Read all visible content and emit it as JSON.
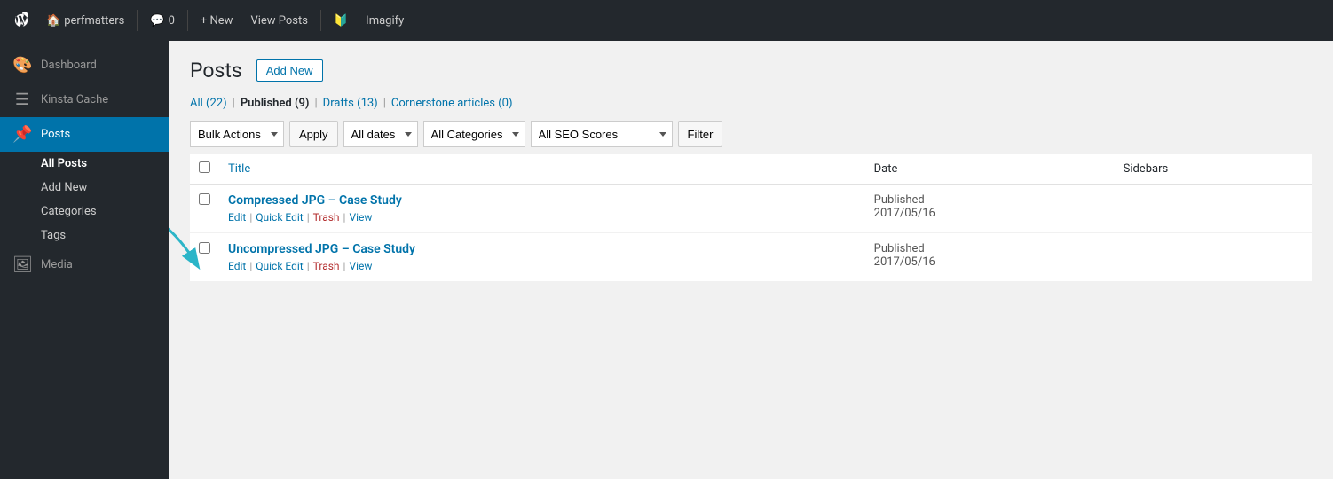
{
  "adminbar": {
    "wp_logo": "W",
    "site_name": "perfmatters",
    "comments_icon": "💬",
    "comments_count": "0",
    "new_label": "+ New",
    "view_posts_label": "View Posts",
    "yoast_icon": "Y",
    "imagify_label": "Imagify"
  },
  "sidebar": {
    "dashboard_label": "Dashboard",
    "kinsta_cache_label": "Kinsta Cache",
    "posts_label": "Posts",
    "all_posts_label": "All Posts",
    "add_new_label": "Add New",
    "categories_label": "Categories",
    "tags_label": "Tags",
    "media_label": "Media"
  },
  "content": {
    "page_title": "Posts",
    "add_new_btn": "Add New",
    "filter_links": [
      {
        "label": "All (22)",
        "active": false
      },
      {
        "label": "Published (9)",
        "active": true
      },
      {
        "label": "Drafts (13)",
        "active": false
      },
      {
        "label": "Cornerstone articles (0)",
        "active": false
      }
    ],
    "bulk_actions_label": "Bulk Actions",
    "apply_label": "Apply",
    "all_dates_label": "All dates",
    "all_categories_label": "All Categories",
    "all_seo_scores_label": "All SEO Scores",
    "filter_btn": "Filter",
    "table": {
      "headers": [
        "",
        "Title",
        "Date",
        "Sidebars"
      ],
      "rows": [
        {
          "title": "Compressed JPG – Case Study",
          "status": "Published",
          "date": "2017/05/16",
          "actions": [
            "Edit",
            "Quick Edit",
            "Trash",
            "View"
          ]
        },
        {
          "title": "Uncompressed JPG – Case Study",
          "status": "Published",
          "date": "2017/05/16",
          "actions": [
            "Edit",
            "Quick Edit",
            "Trash",
            "View"
          ]
        }
      ]
    }
  }
}
